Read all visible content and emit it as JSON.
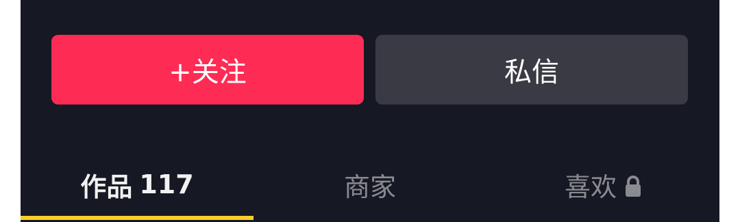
{
  "actions": {
    "follow_label": "+关注",
    "message_label": "私信"
  },
  "tabs": [
    {
      "label": "作品",
      "count": "117",
      "selected": true
    },
    {
      "label": "商家",
      "selected": false
    },
    {
      "label": "喜欢",
      "locked": true,
      "icon": "lock-icon",
      "selected": false
    }
  ],
  "colors": {
    "background": "#161823",
    "follow_button": "#fe2c55",
    "message_button": "#3a3a44",
    "active_tab_text": "#f1f1f2",
    "inactive_tab_text": "#8a8b91",
    "tab_indicator": "#facd28"
  }
}
